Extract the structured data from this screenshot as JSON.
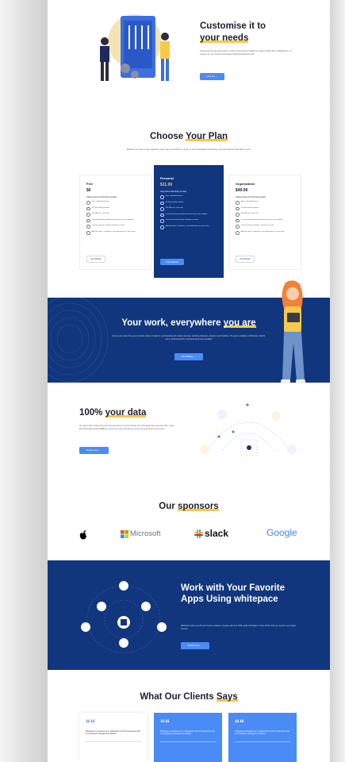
{
  "customise": {
    "title_a": "Customise it to",
    "title_b": "your needs",
    "desc": "Customise the app with plugins, custom themes and multiple text editors (Rich Text or Markdown). Or create your own scripts and plugins using the Extension API.",
    "button": "Let's Go →"
  },
  "plans": {
    "title_a": "Choose ",
    "title_b": "Your Plan",
    "subtitle": "Whether you want to get organized, keep your personal life on track, or boost workplace productivity, Evernote has the right plan for you.",
    "items": [
      {
        "name": "Free",
        "price": "$0",
        "desc": "Capture ideas and find them quickly",
        "features": [
          "Sync unlimited devices",
          "10 GB monthly uploads",
          "200 MB max. note size",
          "Customize Home dashboard and access extra widgets",
          "Connect primary Google Calendar account",
          "Add due dates, reminders, and notifications to your tasks"
        ],
        "button": "Get Started"
      },
      {
        "name": "Personal",
        "price": "$11.99",
        "desc": "Keep home and family on track",
        "features": [
          "Sync unlimited devices",
          "10 GB monthly uploads",
          "200 MB max. note size",
          "Customize Home dashboard and access extra widgets",
          "Connect primary Google Calendar account",
          "Add due dates, reminders, and notifications to your tasks"
        ],
        "button": "Get Started"
      },
      {
        "name": "Organization",
        "price": "$49.99",
        "desc": "Capture ideas and find them quickly",
        "features": [
          "Sync unlimited devices",
          "10 GB monthly uploads",
          "200 MB max. note size",
          "Customize Home dashboard and access extra widgets",
          "Connect primary Google Calendar account",
          "Add due dates, reminders, and notifications to your tasks"
        ],
        "button": "Get Started"
      }
    ]
  },
  "everywhere": {
    "title_a": "Your work, everywhere ",
    "title_b": "you are",
    "desc": "Access your notes from your computer, phone or tablet by synchronising with various services, including whitepace, Dropbox and OneDrive. The app is available on Windows, macOS, Linux, Android and iOS. A terminal app is also available!",
    "button": "Try Taskey →"
  },
  "data": {
    "title_a": "100% ",
    "title_b": "your data",
    "desc": "The app is open source and your notes are saved to an open format, so you'll always have access to them. Uses End-To-End Encryption (E2EE) to secure your notes and ensure no-one but yourself can access them.",
    "button": "Read more →"
  },
  "sponsors": {
    "title_a": "Our ",
    "title_b": "sponsors",
    "logos": [
      "Microsoft",
      "slack",
      "Google"
    ]
  },
  "apps": {
    "title": "Work with Your Favorite Apps Using whitepace",
    "desc": "Whitepace teams up with your favorite software. Integrate with over 1000+ apps with Zapier to have all the tools you need for your project success.",
    "button": "Read more →"
  },
  "clients": {
    "title_a": "What Our Clients ",
    "title_b": "Says",
    "cards": [
      {
        "text": "Whitepace is designed as a collaboration tool for businesses that is a full project management solution."
      },
      {
        "text": "Whitepace is designed as a collaboration tool for businesses that is a full project management solution."
      },
      {
        "text": "Whitepace is designed as a collaboration tool for businesses that is a full project management solution."
      }
    ]
  },
  "colors": {
    "navy": "#11367d",
    "accent": "#4a8bf5",
    "highlight": "#f6c94a"
  }
}
